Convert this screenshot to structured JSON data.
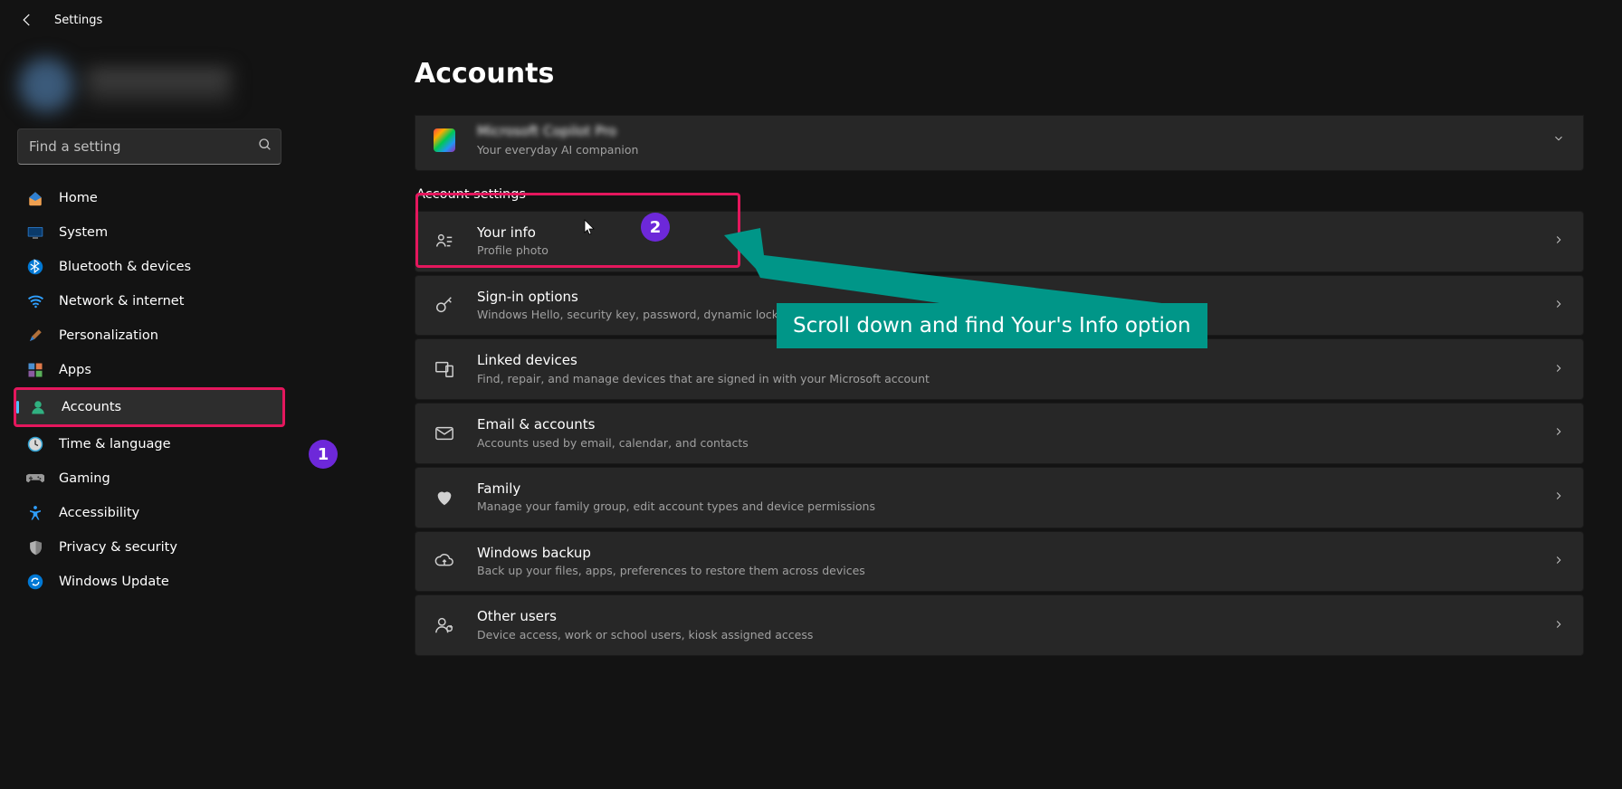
{
  "app_title": "Settings",
  "search_placeholder": "Find a setting",
  "page_title": "Accounts",
  "nav": [
    {
      "key": "home",
      "label": "Home"
    },
    {
      "key": "system",
      "label": "System"
    },
    {
      "key": "bluetooth",
      "label": "Bluetooth & devices"
    },
    {
      "key": "network",
      "label": "Network & internet"
    },
    {
      "key": "personalization",
      "label": "Personalization"
    },
    {
      "key": "apps",
      "label": "Apps"
    },
    {
      "key": "accounts",
      "label": "Accounts"
    },
    {
      "key": "time",
      "label": "Time & language"
    },
    {
      "key": "gaming",
      "label": "Gaming"
    },
    {
      "key": "accessibility",
      "label": "Accessibility"
    },
    {
      "key": "privacy",
      "label": "Privacy & security"
    },
    {
      "key": "update",
      "label": "Windows Update"
    }
  ],
  "top_card": {
    "title": "Microsoft Copilot Pro",
    "sub": "Your everyday AI companion"
  },
  "section_label": "Account settings",
  "cards": [
    {
      "key": "yourinfo",
      "title": "Your info",
      "sub": "Profile photo"
    },
    {
      "key": "signin",
      "title": "Sign-in options",
      "sub": "Windows Hello, security key, password, dynamic lock"
    },
    {
      "key": "linked",
      "title": "Linked devices",
      "sub": "Find, repair, and manage devices that are signed in with your Microsoft account"
    },
    {
      "key": "email",
      "title": "Email & accounts",
      "sub": "Accounts used by email, calendar, and contacts"
    },
    {
      "key": "family",
      "title": "Family",
      "sub": "Manage your family group, edit account types and device permissions"
    },
    {
      "key": "backup",
      "title": "Windows backup",
      "sub": "Back up your files, apps, preferences to restore them across devices"
    },
    {
      "key": "otherusers",
      "title": "Other users",
      "sub": "Device access, work or school users, kiosk assigned access"
    }
  ],
  "annotation": {
    "badge1": "1",
    "badge2": "2",
    "callout": "Scroll down and find Your's Info option"
  }
}
